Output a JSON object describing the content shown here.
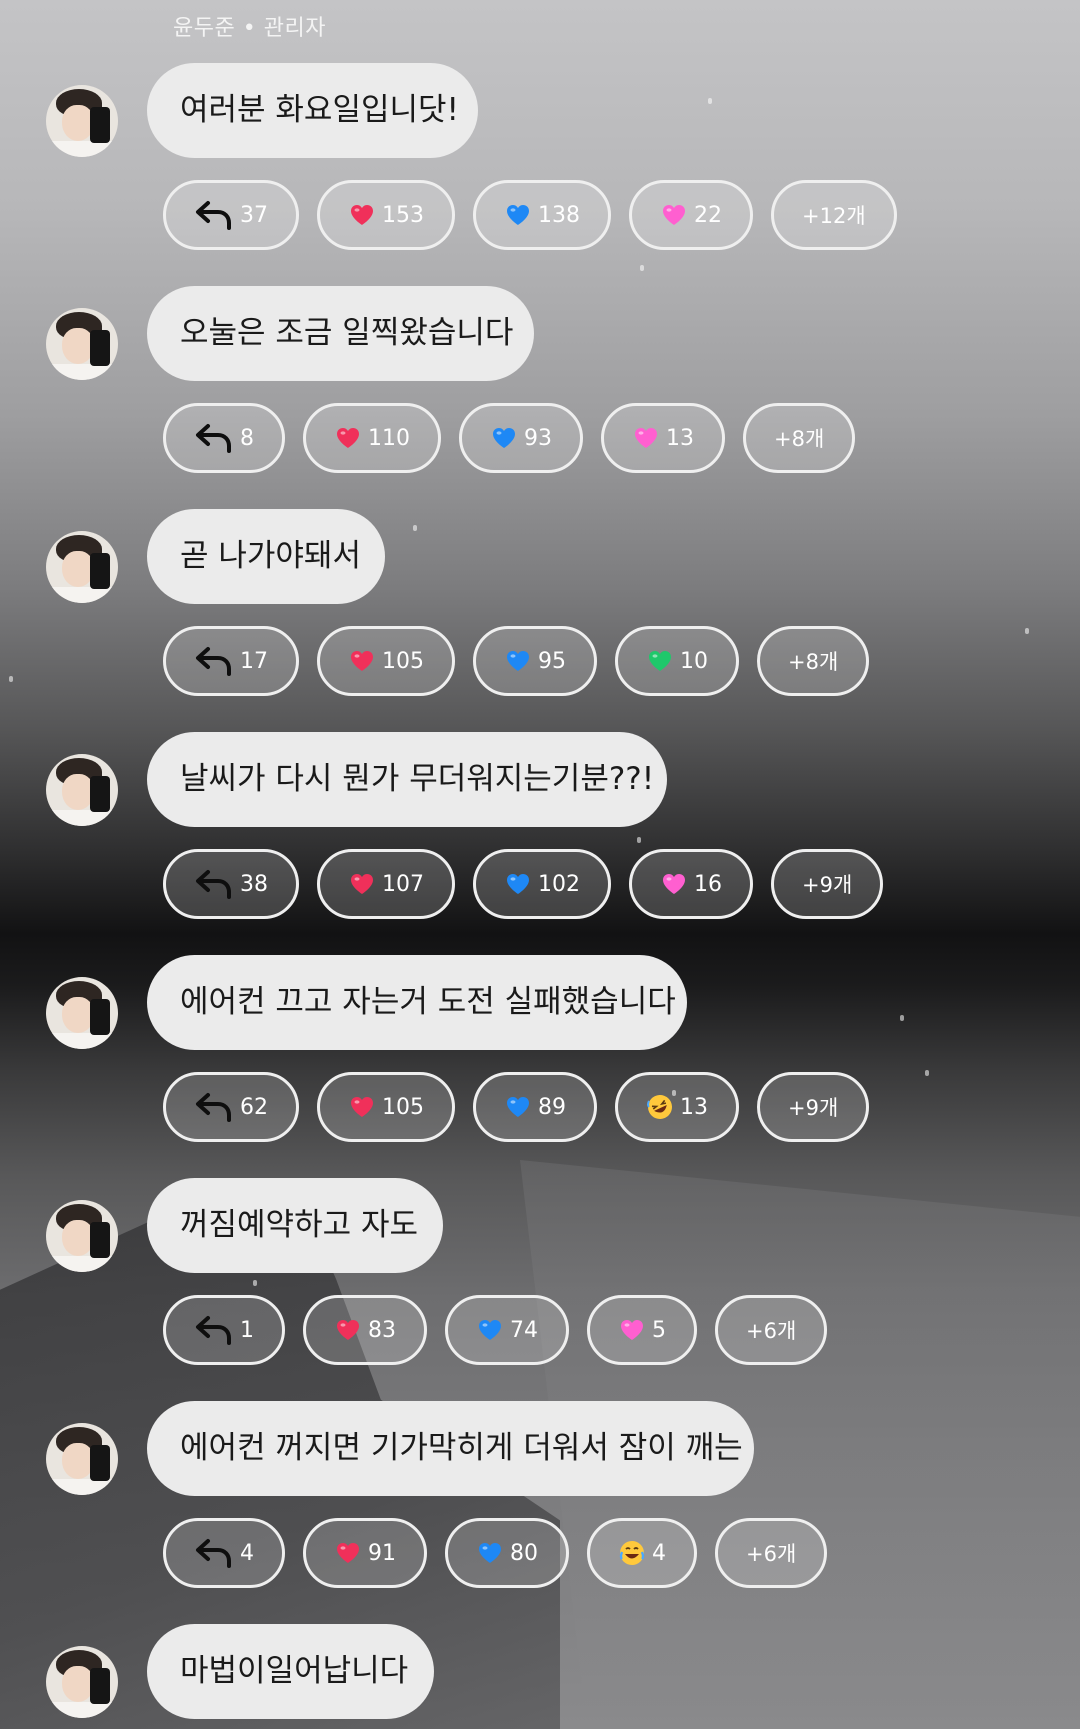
{
  "sender": {
    "name": "윤두준",
    "separator": "•",
    "role": "관리자"
  },
  "colors": {
    "bubble": "#ebebeb",
    "chip_border": "#efefef",
    "heart_red": "#f0305a",
    "heart_blue": "#1e88f5",
    "heart_pink": "#ff5fd0",
    "heart_green": "#1ec86b"
  },
  "messages": [
    {
      "text": "여러분 화요일입니닷!",
      "reactions": [
        {
          "icon": "reply-arrow-icon",
          "count": "37"
        },
        {
          "icon": "red-heart-icon",
          "count": "153"
        },
        {
          "icon": "blue-heart-icon",
          "count": "138"
        },
        {
          "icon": "pink-heart-icon",
          "count": "22"
        }
      ],
      "more": "+12개"
    },
    {
      "text": "오눌은 조금 일찍왔습니다",
      "reactions": [
        {
          "icon": "reply-arrow-icon",
          "count": "8"
        },
        {
          "icon": "red-heart-icon",
          "count": "110"
        },
        {
          "icon": "blue-heart-icon",
          "count": "93"
        },
        {
          "icon": "pink-heart-icon",
          "count": "13"
        }
      ],
      "more": "+8개"
    },
    {
      "text": "곧 나가야돼서",
      "reactions": [
        {
          "icon": "reply-arrow-icon",
          "count": "17"
        },
        {
          "icon": "red-heart-icon",
          "count": "105"
        },
        {
          "icon": "blue-heart-icon",
          "count": "95"
        },
        {
          "icon": "green-heart-icon",
          "count": "10"
        }
      ],
      "more": "+8개"
    },
    {
      "text": "날씨가 다시 뭔가 무더워지는기분??!",
      "reactions": [
        {
          "icon": "reply-arrow-icon",
          "count": "38"
        },
        {
          "icon": "red-heart-icon",
          "count": "107"
        },
        {
          "icon": "blue-heart-icon",
          "count": "102"
        },
        {
          "icon": "pink-heart-icon",
          "count": "16"
        }
      ],
      "more": "+9개"
    },
    {
      "text": "에어컨 끄고 자는거 도전 실패했습니다",
      "reactions": [
        {
          "icon": "reply-arrow-icon",
          "count": "62"
        },
        {
          "icon": "red-heart-icon",
          "count": "105"
        },
        {
          "icon": "blue-heart-icon",
          "count": "89"
        },
        {
          "icon": "rofl-emoji-icon",
          "count": "13"
        }
      ],
      "more": "+9개"
    },
    {
      "text": "꺼짐예약하고 자도",
      "reactions": [
        {
          "icon": "reply-arrow-icon",
          "count": "1"
        },
        {
          "icon": "red-heart-icon",
          "count": "83"
        },
        {
          "icon": "blue-heart-icon",
          "count": "74"
        },
        {
          "icon": "pink-heart-icon",
          "count": "5"
        }
      ],
      "more": "+6개"
    },
    {
      "text": "에어컨 꺼지면 기가막히게 더워서 잠이 깨는",
      "reactions": [
        {
          "icon": "reply-arrow-icon",
          "count": "4"
        },
        {
          "icon": "red-heart-icon",
          "count": "91"
        },
        {
          "icon": "blue-heart-icon",
          "count": "80"
        },
        {
          "icon": "joy-emoji-icon",
          "count": "4"
        }
      ],
      "more": "+6개"
    },
    {
      "text": "마법이일어납니다",
      "reactions": [],
      "more": ""
    }
  ]
}
